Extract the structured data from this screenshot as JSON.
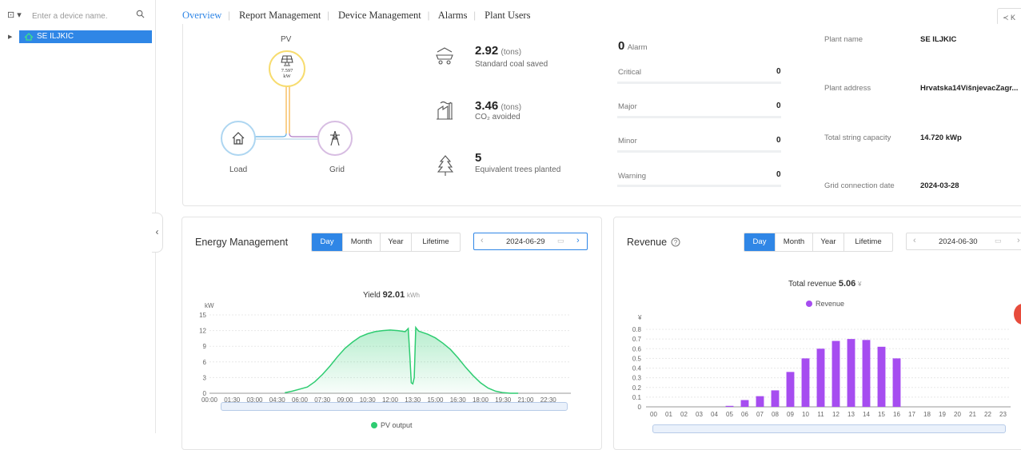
{
  "sidebar": {
    "search_placeholder": "Enter a device name.",
    "tree": [
      {
        "label": "SE ILJKIC"
      }
    ]
  },
  "nav": {
    "tabs": [
      "Overview",
      "Report Management",
      "Device Management",
      "Alarms",
      "Plant Users"
    ],
    "active": "Overview"
  },
  "flow": {
    "pv_label": "PV",
    "pv_power": "7.597",
    "pv_unit": "kW",
    "load_label": "Load",
    "grid_label": "Grid"
  },
  "environment": [
    {
      "value": "2.92",
      "unit": "(tons)",
      "label": "Standard coal saved",
      "icon": "coal-truck-icon"
    },
    {
      "value": "3.46",
      "unit": "(tons)",
      "label": "CO₂ avoided",
      "icon": "factory-icon"
    },
    {
      "value": "5",
      "unit": "",
      "label": "Equivalent trees planted",
      "icon": "tree-icon"
    }
  ],
  "alarms": {
    "total": "0",
    "total_label": "Alarm",
    "levels": [
      {
        "label": "Critical",
        "value": "0"
      },
      {
        "label": "Major",
        "value": "0"
      },
      {
        "label": "Minor",
        "value": "0"
      },
      {
        "label": "Warning",
        "value": "0"
      }
    ]
  },
  "plant_info": [
    {
      "label": "Plant name",
      "value": "SE ILJKIC"
    },
    {
      "label": "Plant address",
      "value": "Hrvatska14VišnjevacZagr..."
    },
    {
      "label": "Total string capacity",
      "value": "14.720 kWp"
    },
    {
      "label": "Grid connection date",
      "value": "2024-03-28"
    }
  ],
  "energy": {
    "title": "Energy Management",
    "periods": [
      "Day",
      "Month",
      "Year",
      "Lifetime"
    ],
    "active_period": "Day",
    "date": "2024-06-29",
    "yield_label": "Yield",
    "yield_value": "92.01",
    "yield_unit": "kWh"
  },
  "revenue": {
    "title": "Revenue",
    "periods": [
      "Day",
      "Month",
      "Year",
      "Lifetime"
    ],
    "active_period": "Day",
    "date": "2024-06-30",
    "total_label": "Total revenue",
    "total_value": "5.06",
    "total_unit": "¥"
  },
  "colors": {
    "accent": "#2f86e6",
    "pv_line": "#2ecc71",
    "revenue_bar": "#a64df0"
  },
  "chart_data": [
    {
      "type": "area",
      "title": "",
      "ylabel": "kW",
      "ylim": [
        0,
        15
      ],
      "yticks": [
        0,
        3,
        6,
        9,
        12,
        15
      ],
      "xlim": [
        0,
        24
      ],
      "xtick_labels": [
        "00:00",
        "01:30",
        "03:00",
        "04:30",
        "06:00",
        "07:30",
        "09:00",
        "10:30",
        "12:00",
        "13:30",
        "15:00",
        "16:30",
        "18:00",
        "19:30",
        "21:00",
        "22:30"
      ],
      "series": [
        {
          "name": "PV output",
          "x": [
            5.0,
            5.5,
            6.0,
            6.5,
            7.0,
            7.5,
            8.0,
            8.5,
            9.0,
            9.5,
            10.0,
            10.5,
            11.0,
            11.5,
            12.0,
            12.5,
            13.0,
            13.2,
            13.3,
            13.4,
            13.5,
            13.6,
            13.7,
            13.8,
            13.9,
            14.0,
            14.5,
            15.0,
            15.5,
            16.0,
            16.5,
            17.0,
            17.5,
            18.0,
            18.5,
            19.0,
            19.5,
            20.0,
            20.5
          ],
          "values": [
            0.1,
            0.4,
            0.8,
            1.2,
            2.2,
            3.6,
            5.2,
            7.0,
            8.6,
            9.8,
            10.8,
            11.4,
            11.8,
            12.0,
            12.1,
            12.0,
            11.8,
            12.4,
            7.5,
            2.0,
            1.8,
            3.0,
            12.6,
            12.2,
            11.9,
            11.8,
            11.3,
            10.6,
            9.6,
            8.4,
            6.8,
            5.0,
            3.4,
            2.0,
            1.0,
            0.4,
            0.1,
            0.0,
            0.0
          ]
        }
      ],
      "grid": true,
      "legend": "bottom"
    },
    {
      "type": "bar",
      "title": "",
      "ylabel": "¥",
      "ylim": [
        0,
        0.8
      ],
      "yticks": [
        0,
        0.1,
        0.2,
        0.3,
        0.4,
        0.5,
        0.6,
        0.7,
        0.8
      ],
      "categories": [
        "00",
        "01",
        "02",
        "03",
        "04",
        "05",
        "06",
        "07",
        "08",
        "09",
        "10",
        "11",
        "12",
        "13",
        "14",
        "15",
        "16",
        "17",
        "18",
        "19",
        "20",
        "21",
        "22",
        "23"
      ],
      "series": [
        {
          "name": "Revenue",
          "values": [
            0,
            0,
            0,
            0,
            0,
            0.01,
            0.07,
            0.11,
            0.17,
            0.36,
            0.5,
            0.6,
            0.68,
            0.7,
            0.69,
            0.62,
            0.5,
            0,
            0,
            0,
            0,
            0,
            0,
            0
          ]
        }
      ],
      "grid": true,
      "legend": "top"
    }
  ]
}
